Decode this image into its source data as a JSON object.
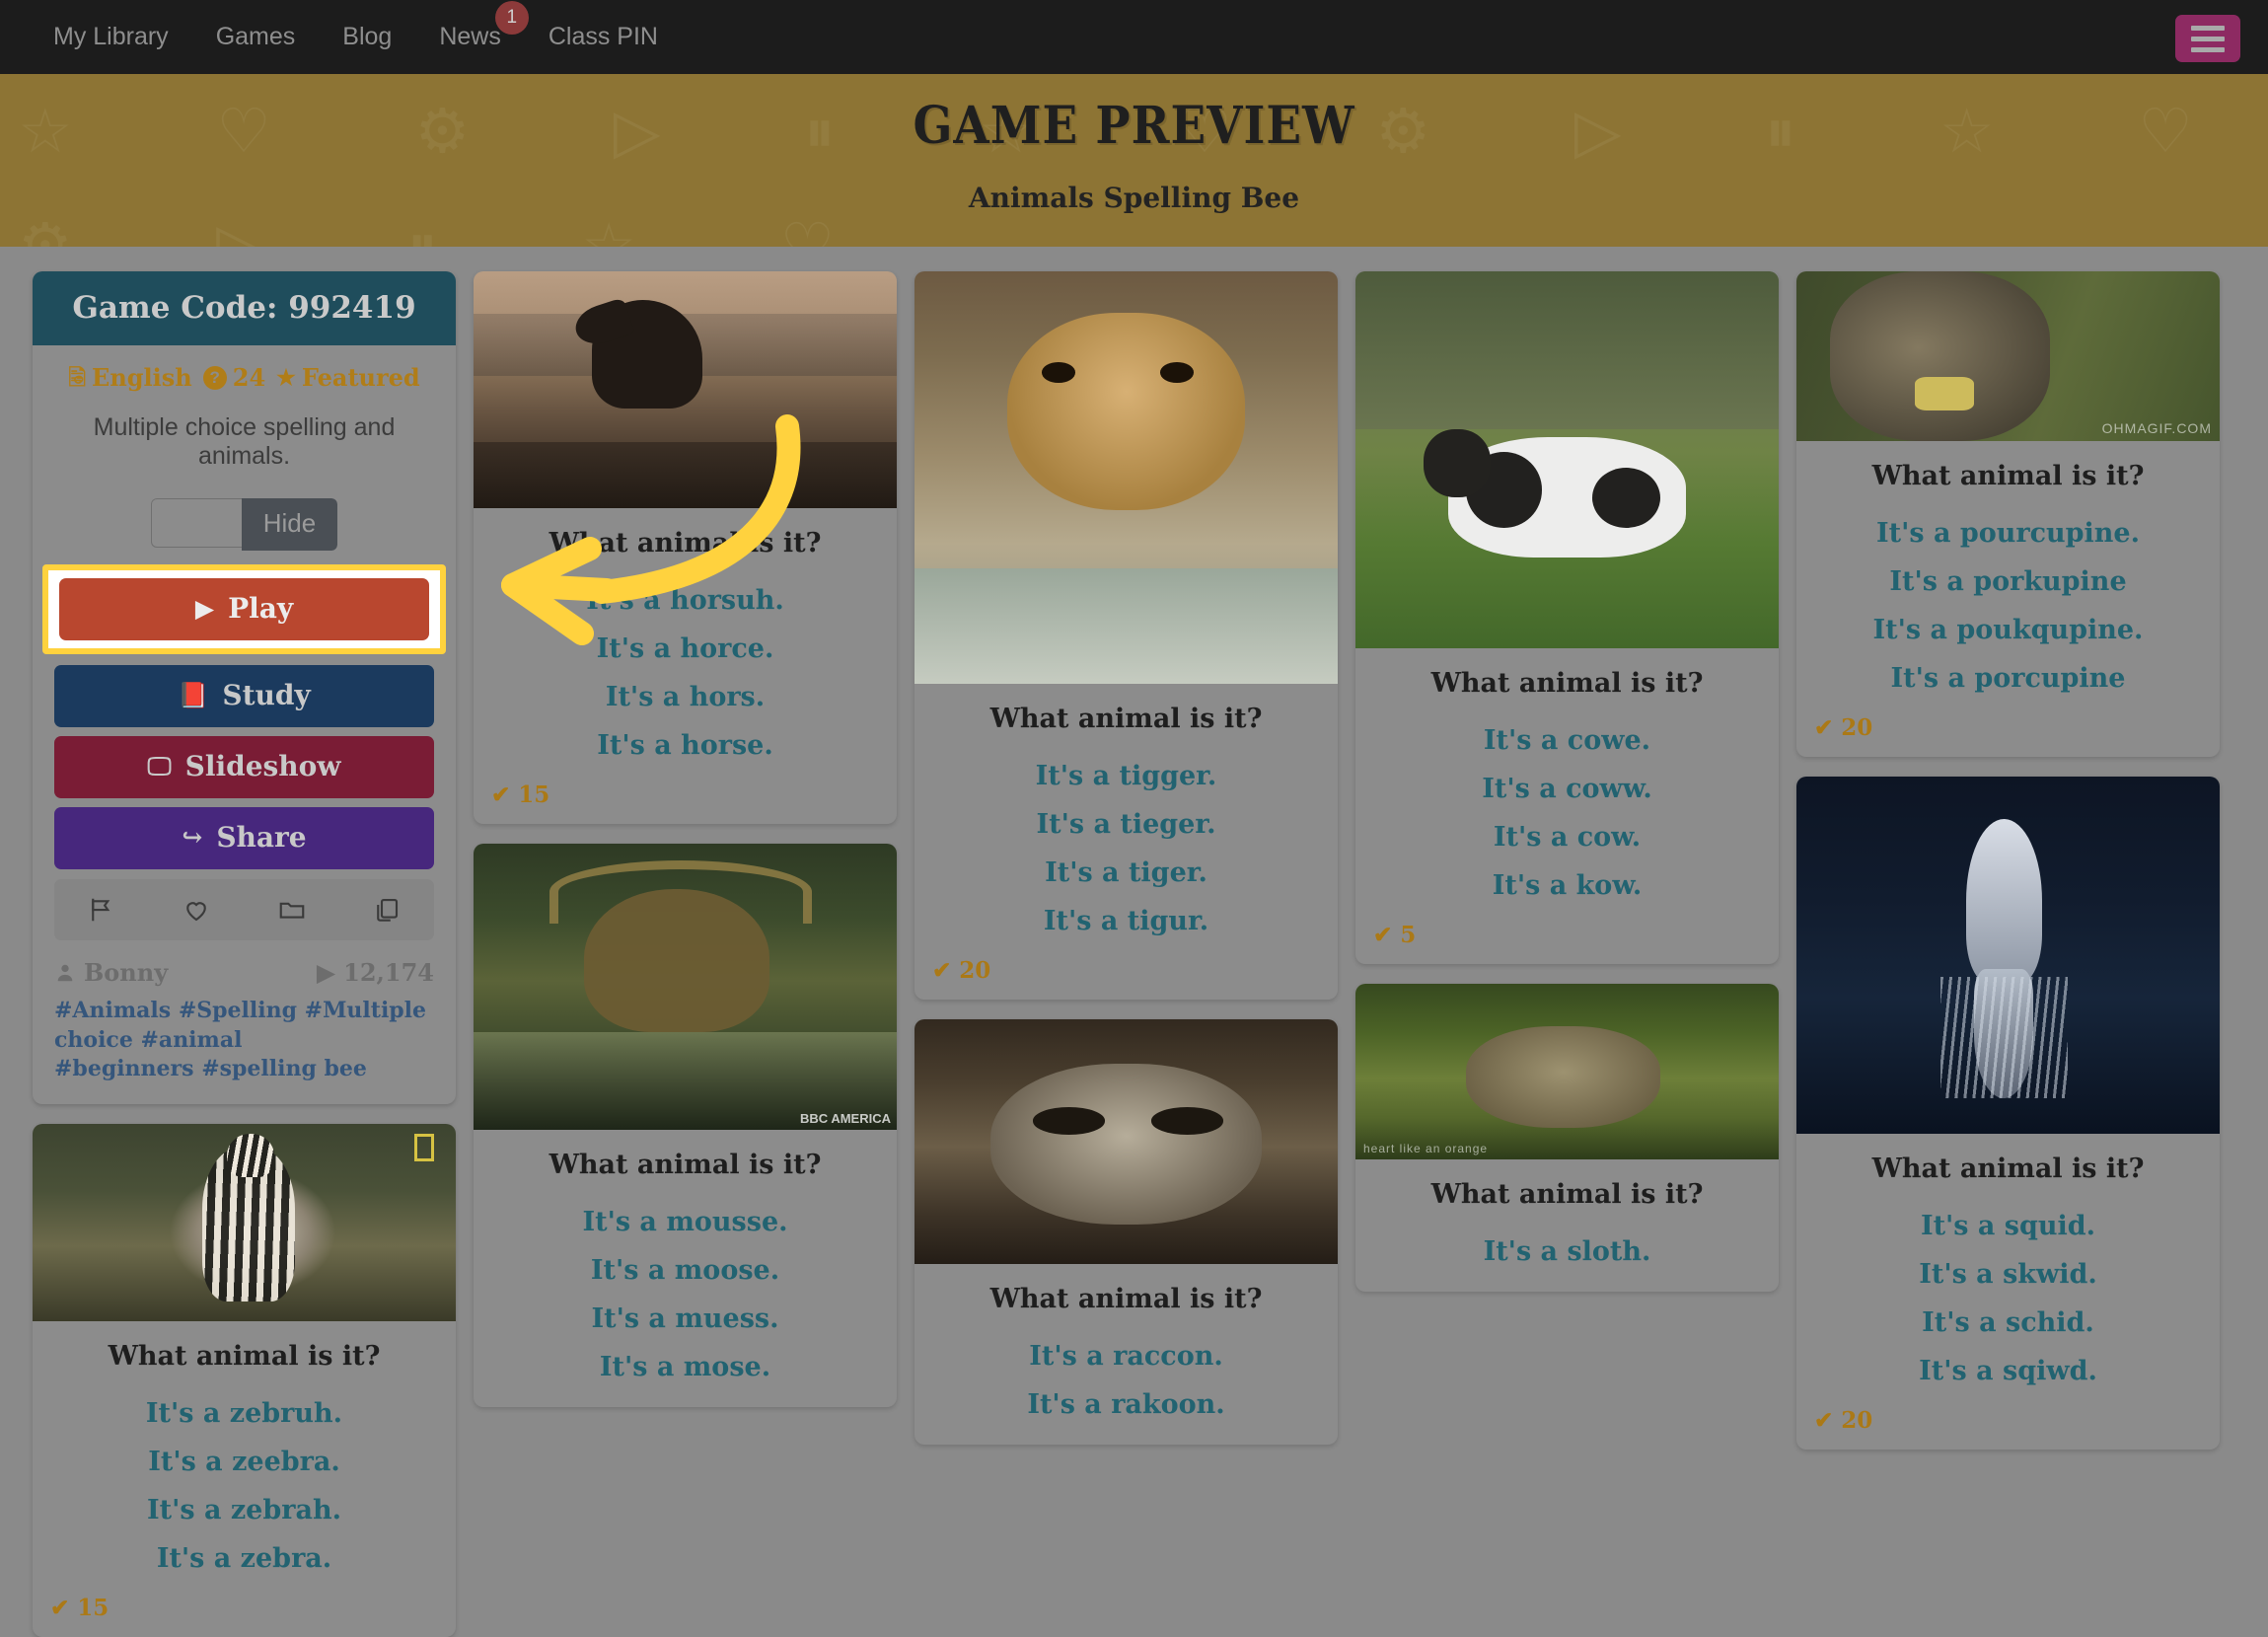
{
  "nav": {
    "links": [
      {
        "label": "My Library",
        "badge": null
      },
      {
        "label": "Games",
        "badge": null
      },
      {
        "label": "Blog",
        "badge": null
      },
      {
        "label": "News",
        "badge": "1"
      },
      {
        "label": "Class PIN",
        "badge": null
      }
    ],
    "menu_icon": "hamburger-icon"
  },
  "hero": {
    "title": "Game Preview",
    "subtitle": "Animals Spelling Bee",
    "background_color": "#8d7434"
  },
  "info_card": {
    "game_code_label": "Game Code: 992419",
    "language": "English",
    "question_count": "24",
    "featured_label": "Featured",
    "description": "Multiple choice spelling and animals.",
    "toggle": {
      "value": "",
      "on_label": "Hide"
    },
    "buttons": [
      {
        "name": "play",
        "label": "Play",
        "icon": "play-icon",
        "color": "#b9472f",
        "highlighted": true
      },
      {
        "name": "study",
        "label": "Study",
        "icon": "book-icon",
        "color": "#1b3a5e",
        "highlighted": false
      },
      {
        "name": "slideshow",
        "label": "Slideshow",
        "icon": "monitor-icon",
        "color": "#7a1c35",
        "highlighted": false
      },
      {
        "name": "share",
        "label": "Share",
        "icon": "share-arrow-icon",
        "color": "#47277d",
        "highlighted": false
      }
    ],
    "actions": [
      "flag-icon",
      "heart-icon",
      "folder-icon",
      "copy-icon"
    ],
    "author": "Bonny",
    "plays": "12,174",
    "tags": [
      "#Animals",
      "#Spelling",
      "#Multiple choice",
      "#animal",
      "#beginners",
      "#spelling bee"
    ]
  },
  "cards": [
    {
      "id": "horse",
      "question": "What animal is it?",
      "options": [
        "It's a horsuh.",
        "It's a horce.",
        "It's a hors.",
        "It's a horse."
      ],
      "count": "15",
      "image_alt": "horse-on-ridge-photo",
      "watermark": ""
    },
    {
      "id": "tiger",
      "question": "What animal is it?",
      "options": [
        "It's a tigger.",
        "It's a tieger.",
        "It's a tiger.",
        "It's a tigur."
      ],
      "count": "20",
      "image_alt": "tiger-cub-photo",
      "watermark": ""
    },
    {
      "id": "cow",
      "question": "What animal is it?",
      "options": [
        "It's a cowe.",
        "It's a coww.",
        "It's a cow.",
        "It's a kow."
      ],
      "count": "5",
      "image_alt": "cow-in-field-photo",
      "watermark": ""
    },
    {
      "id": "porcupine",
      "question": "What animal is it?",
      "options": [
        "It's a pourcupine.",
        "It's a porkupine",
        "It's a poukqupine.",
        "It's a porcupine"
      ],
      "count": "20",
      "image_alt": "porcupine-eating-corn-photo",
      "watermark": "OHMAGIF.COM"
    },
    {
      "id": "zebra",
      "question": "What animal is it?",
      "options": [
        "It's a zebruh.",
        "It's a zeebra.",
        "It's a zebrah.",
        "It's a zebra."
      ],
      "count": "15",
      "image_alt": "zebra-photo",
      "watermark": ""
    },
    {
      "id": "moose",
      "question": "What animal is it?",
      "options": [
        "It's a mousse.",
        "It's a moose.",
        "It's a muess.",
        "It's a mose."
      ],
      "count": "",
      "image_alt": "moose-in-water-photo",
      "watermark": "BBC AMERICA"
    },
    {
      "id": "raccoon",
      "question": "What animal is it?",
      "options": [
        "It's a raccon.",
        "It's a rakoon."
      ],
      "count": "",
      "image_alt": "raccoon-photo",
      "watermark": ""
    },
    {
      "id": "sloth",
      "question": "What animal is it?",
      "options": [
        "It's a sloth."
      ],
      "count": "",
      "image_alt": "sloth-in-tree-photo",
      "watermark": "heart like an orange"
    },
    {
      "id": "squid",
      "question": "What animal is it?",
      "options": [
        "It's a squid.",
        "It's a skwid.",
        "It's a schid.",
        "It's a sqiwd."
      ],
      "count": "20",
      "image_alt": "squid-photo",
      "watermark": ""
    }
  ],
  "annotation": {
    "type": "curved-arrow",
    "color": "#ffd23e",
    "points_to": "play-button"
  },
  "colors": {
    "page_background": "#8a8a8a",
    "nav_background": "#1c1c1c",
    "hero_background": "#8d7434",
    "card_background": "#8c8c8c",
    "info_header": "#1f4d5c",
    "option_text": "#226371",
    "meta_gold": "#b07d18",
    "highlight_yellow": "#ffd23e"
  }
}
